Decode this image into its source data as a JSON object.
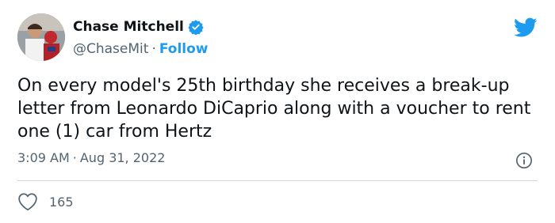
{
  "author": {
    "name": "Chase Mitchell",
    "handle": "@ChaseMit",
    "separator": "·",
    "follow_label": "Follow"
  },
  "tweet": {
    "text": "On every model's 25th birthday she receives a break-up letter from Leonardo DiCaprio along with a voucher to rent one (1) car from Hertz",
    "time": "3:09 AM",
    "separator": "·",
    "date": "Aug 31, 2022"
  },
  "stats": {
    "likes": "165"
  },
  "icons": {
    "verified": "verified-badge-icon",
    "brand": "twitter-bird-icon",
    "info": "info-icon",
    "like": "heart-icon"
  },
  "colors": {
    "accent": "#1d9bf0",
    "text": "#0f1419",
    "muted": "#536471",
    "divider": "#cfd9de"
  }
}
